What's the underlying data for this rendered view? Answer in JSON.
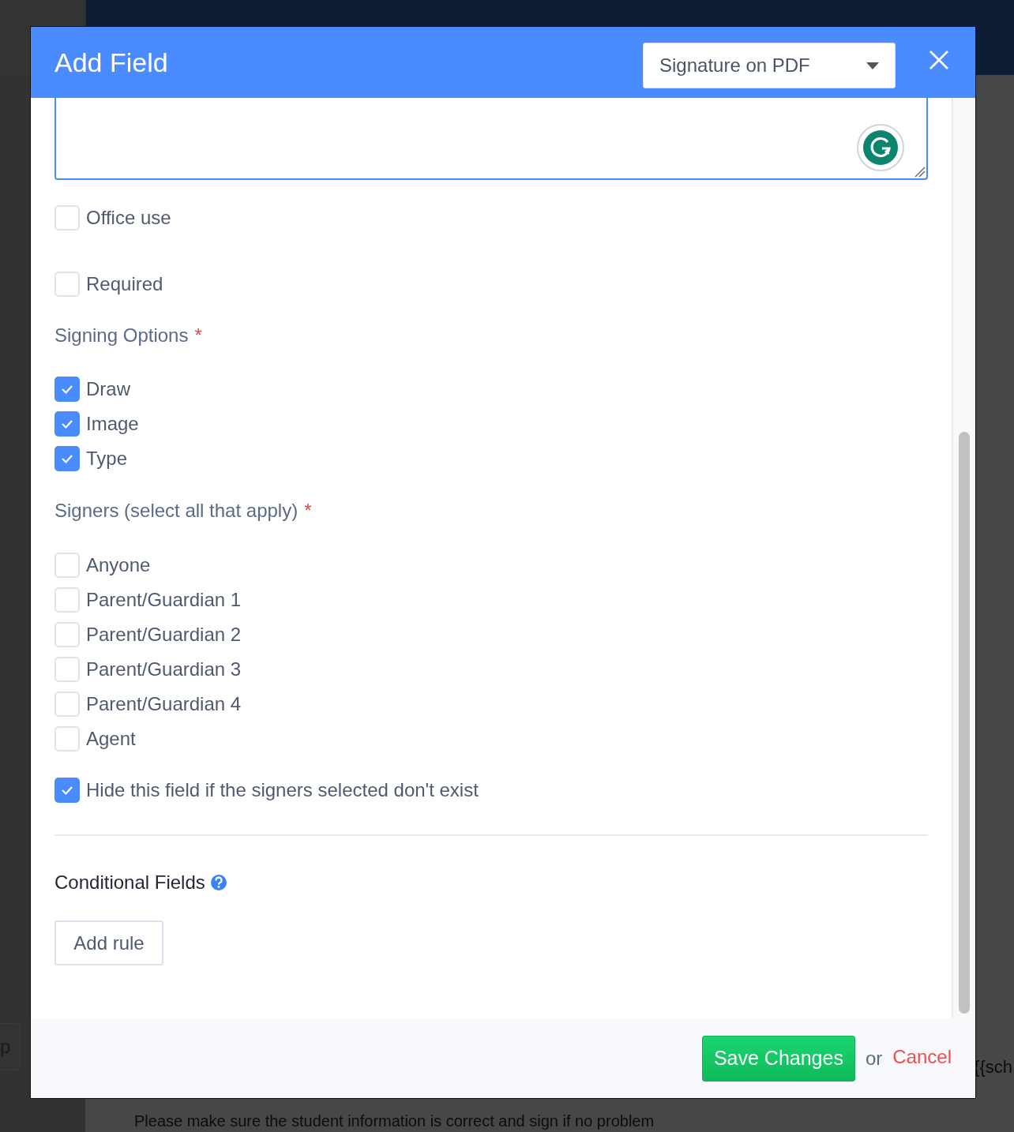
{
  "backdrop": {
    "side_button": "p",
    "template_text": "{{sch",
    "note": "Please make sure the student information is correct and sign if no problem"
  },
  "modal": {
    "title": "Add Field",
    "type_select": {
      "value": "Signature on PDF"
    },
    "general_options": [
      {
        "label": "Office use",
        "checked": false
      },
      {
        "label": "Required",
        "checked": false
      }
    ],
    "signing_options": {
      "label": "Signing Options",
      "required_mark": "*",
      "options": [
        {
          "label": "Draw",
          "checked": true
        },
        {
          "label": "Image",
          "checked": true
        },
        {
          "label": "Type",
          "checked": true
        }
      ]
    },
    "signers": {
      "label": "Signers (select all that apply)",
      "required_mark": "*",
      "options": [
        {
          "label": "Anyone",
          "checked": false
        },
        {
          "label": "Parent/Guardian 1",
          "checked": false
        },
        {
          "label": "Parent/Guardian 2",
          "checked": false
        },
        {
          "label": "Parent/Guardian 3",
          "checked": false
        },
        {
          "label": "Parent/Guardian 4",
          "checked": false
        },
        {
          "label": "Agent",
          "checked": false
        }
      ]
    },
    "hide_option": {
      "label": "Hide this field if the signers selected don't exist",
      "checked": true
    },
    "conditional_fields": {
      "label": "Conditional Fields",
      "add_rule_button": "Add rule"
    },
    "footer": {
      "save_button": "Save Changes",
      "or_text": "or",
      "cancel_link": "Cancel"
    }
  }
}
